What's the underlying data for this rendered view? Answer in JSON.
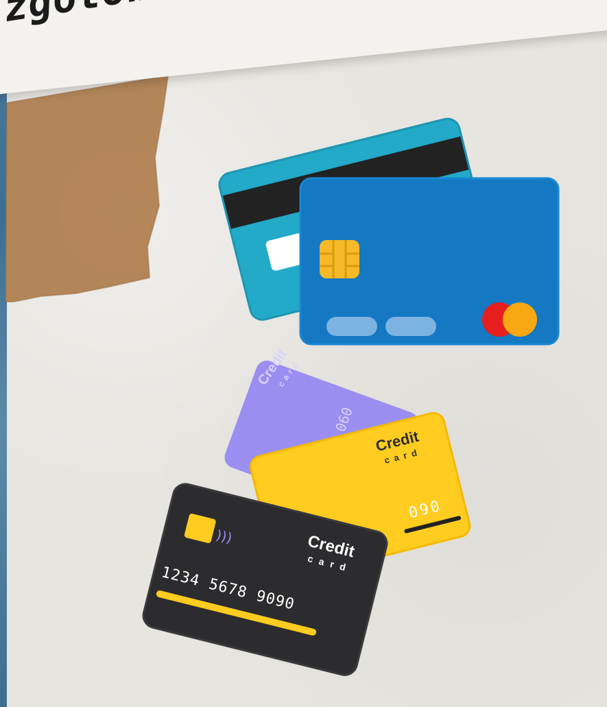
{
  "heading": {
    "text": "zgotówkowej"
  },
  "card_stack_1": {
    "icons": [
      "teal-credit-card-back-icon",
      "blue-credit-card-front-icon",
      "chip-icon",
      "mastercard-logo-icon"
    ]
  },
  "card_stack_2": {
    "black_card": {
      "title": "Credit",
      "subtitle": "card",
      "number": "1234 5678 9090"
    },
    "yellow_card": {
      "title": "Credit",
      "subtitle": "card",
      "number_fragment": "090"
    },
    "purple_card": {
      "title": "Credit",
      "subtitle": "card",
      "number_fragment": "090"
    }
  },
  "colors": {
    "teal": "#23aac8",
    "blue": "#1478c2",
    "yellow": "#ffcc1f",
    "purple": "#9b8ef0",
    "black": "#2c2c2e",
    "chip": "#f6b927",
    "mastercard_red": "#e61e1e",
    "mastercard_yellow": "#f7a813"
  }
}
